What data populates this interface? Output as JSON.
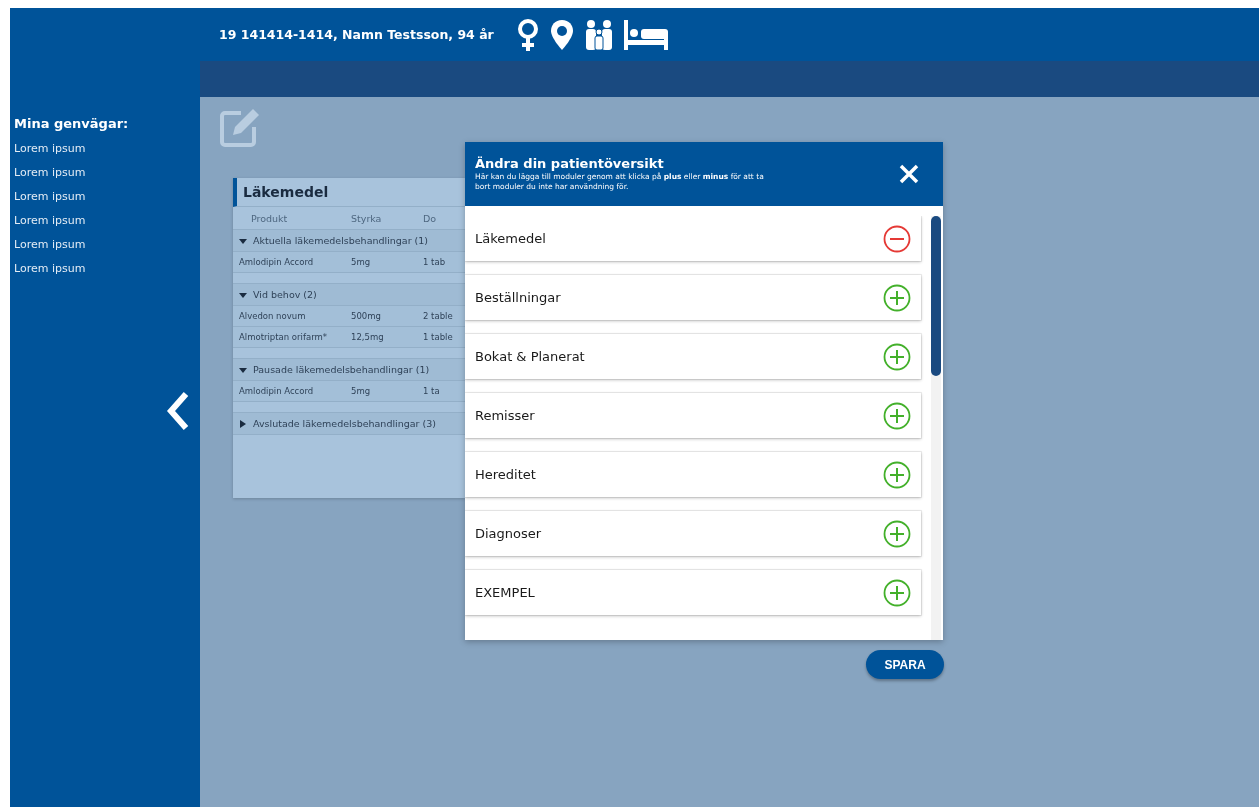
{
  "header": {
    "patient": "19 141414-1414, Namn Testsson, 94 år"
  },
  "sidebar": {
    "title": "Mina genvägar:",
    "items": [
      "Lorem ipsum",
      "Lorem ipsum",
      "Lorem ipsum",
      "Lorem ipsum",
      "Lorem ipsum",
      "Lorem ipsum"
    ]
  },
  "medication_panel": {
    "title": "Läkemedel",
    "columns": [
      "Produkt",
      "Styrka",
      "Do"
    ],
    "groups": [
      {
        "label": "Aktuella läkemedelsbehandlingar (1)",
        "expanded": true,
        "rows": [
          [
            "Amlodipin Accord",
            "5mg",
            "1 tab"
          ]
        ]
      },
      {
        "label": "Vid behov (2)",
        "expanded": true,
        "rows": [
          [
            "Alvedon novum",
            "500mg",
            "2 table"
          ],
          [
            "Almotriptan orifarm*",
            "12,5mg",
            "1 table"
          ]
        ]
      },
      {
        "label": "Pausade läkemedelsbehandlingar (1)",
        "expanded": true,
        "rows": [
          [
            "Amlodipin Accord",
            "5mg",
            "1 ta"
          ]
        ]
      },
      {
        "label": "Avslutade läkemedelsbehandlingar (3)",
        "expanded": false
      }
    ]
  },
  "dialog": {
    "title": "Ändra din patientöversikt",
    "description": "Här kan du lägga till moduler genom att klicka på **plus** eller **minus** för att ta bort moduler du inte har användning för.",
    "modules": [
      {
        "label": "Läkemedel",
        "added": true
      },
      {
        "label": "Beställningar",
        "added": false
      },
      {
        "label": "Bokat & Planerat",
        "added": false
      },
      {
        "label": "Remisser",
        "added": false
      },
      {
        "label": "Hereditet",
        "added": false
      },
      {
        "label": "Diagnoser",
        "added": false
      },
      {
        "label": "EXEMPEL",
        "added": false
      }
    ],
    "save_button": "SPARA"
  }
}
